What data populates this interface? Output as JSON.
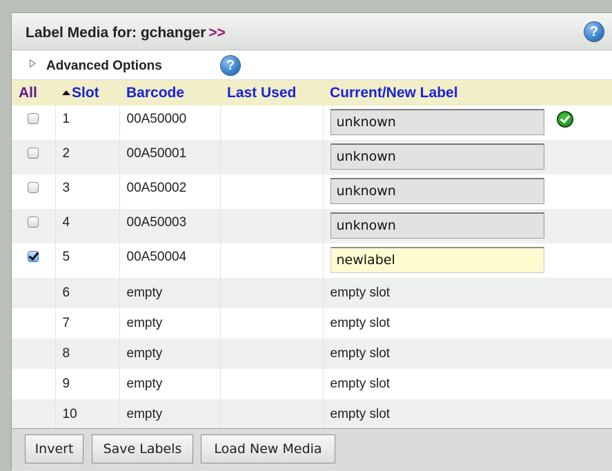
{
  "header": {
    "title": "Label Media for: gchanger",
    "arrows": ">>",
    "help": "?"
  },
  "advanced": {
    "label": "Advanced Options",
    "help": "?"
  },
  "columns": {
    "all": "All",
    "slot": "Slot",
    "barcode": "Barcode",
    "last_used": "Last Used",
    "label": "Current/New Label"
  },
  "rows": [
    {
      "slot": "1",
      "barcode": "00A50000",
      "last_used": "",
      "label": "unknown",
      "checked": false,
      "status": "ok"
    },
    {
      "slot": "2",
      "barcode": "00A50001",
      "last_used": "",
      "label": "unknown",
      "checked": false
    },
    {
      "slot": "3",
      "barcode": "00A50002",
      "last_used": "",
      "label": "unknown",
      "checked": false
    },
    {
      "slot": "4",
      "barcode": "00A50003",
      "last_used": "",
      "label": "unknown",
      "checked": false
    },
    {
      "slot": "5",
      "barcode": "00A50004",
      "last_used": "",
      "label": "newlabel",
      "checked": true
    },
    {
      "slot": "6",
      "barcode": "empty",
      "last_used": "",
      "label": "empty slot"
    },
    {
      "slot": "7",
      "barcode": "empty",
      "last_used": "",
      "label": "empty slot"
    },
    {
      "slot": "8",
      "barcode": "empty",
      "last_used": "",
      "label": "empty slot"
    },
    {
      "slot": "9",
      "barcode": "empty",
      "last_used": "",
      "label": "empty slot"
    },
    {
      "slot": "10",
      "barcode": "empty",
      "last_used": "",
      "label": "empty slot"
    }
  ],
  "buttons": {
    "invert": "Invert",
    "save": "Save Labels",
    "load": "Load New Media"
  }
}
